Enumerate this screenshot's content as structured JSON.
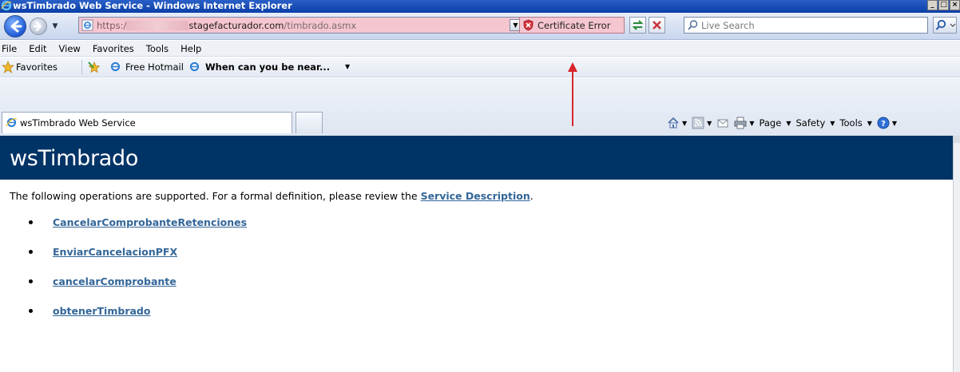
{
  "window": {
    "title": "wsTimbrado Web Service - Windows Internet Explorer"
  },
  "address_bar": {
    "url_scheme": "https:/",
    "url_host": "stagefacturador.com",
    "url_path": "/timbrado.asmx",
    "certificate_error_label": "Certificate Error"
  },
  "search": {
    "placeholder": "Live Search"
  },
  "menu": {
    "items": [
      "File",
      "Edit",
      "View",
      "Favorites",
      "Tools",
      "Help"
    ]
  },
  "favorites_bar": {
    "favorites_label": "Favorites",
    "free_hotmail": "Free Hotmail",
    "when_near": "When can you be near..."
  },
  "tabs": {
    "active_title": "wsTimbrado Web Service"
  },
  "command_bar": {
    "page_label": "Page",
    "safety_label": "Safety",
    "tools_label": "Tools"
  },
  "page": {
    "header_title": "wsTimbrado",
    "intro_text": "The following operations are supported. For a formal definition, please review the ",
    "service_description_link": "Service Description",
    "intro_end": ".",
    "operations": [
      "CancelarComprobanteRetenciones",
      "EnviarCancelacionPFX",
      "cancelarComprobante",
      "obtenerTimbrado"
    ]
  },
  "colors": {
    "page_header_bg": "#003366",
    "link": "#336699",
    "address_error_bg": "#f6c6d0",
    "annotation_arrow": "#d9262c"
  },
  "icons": {
    "back": "back-arrow-icon",
    "forward": "forward-arrow-icon",
    "certificate_error": "shield-error-icon",
    "refresh": "refresh-icon",
    "stop": "stop-icon",
    "search": "search-icon",
    "home": "home-icon",
    "feeds": "rss-icon",
    "mail": "mail-icon",
    "print": "print-icon",
    "help": "help-icon"
  }
}
